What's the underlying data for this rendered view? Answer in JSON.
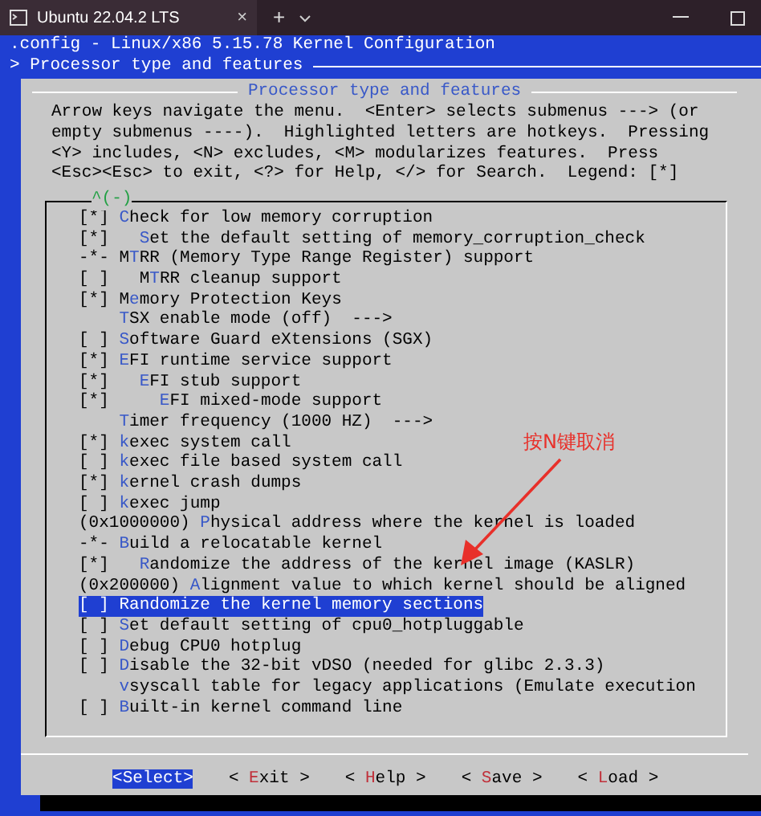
{
  "window": {
    "tab_title": "Ubuntu 22.04.2 LTS",
    "close_tab": "×",
    "new_tab": "+"
  },
  "terminal": {
    "header": ".config - Linux/x86 5.15.78 Kernel Configuration",
    "breadcrumb": "> Processor type and features"
  },
  "dialog": {
    "title": "Processor type and features",
    "help_text": "Arrow keys navigate the menu.  <Enter> selects submenus ---> (or\nempty submenus ----).  Highlighted letters are hotkeys.  Pressing\n<Y> includes, <N> excludes, <M> modularizes features.  Press\n<Esc><Esc> to exit, <?> for Help, </> for Search.  Legend: [*]",
    "scroll_indicator": "^(-)",
    "items": [
      {
        "marker": "[*]",
        "key": "C",
        "post": "heck for low memory corruption",
        "selected": false,
        "children": [
          {
            "marker": "[*]",
            "key": "S",
            "post": "et the default setting of memory_corruption_check",
            "selected": false
          }
        ]
      },
      {
        "marker": "-*-",
        "pre": "M",
        "key": "T",
        "post": "RR (Memory Type Range Register) support",
        "selected": false,
        "children": [
          {
            "marker": "[ ]",
            "pre": "M",
            "key": "T",
            "post": "RR cleanup support",
            "selected": false
          }
        ]
      },
      {
        "marker": "[*]",
        "pre": "M",
        "key": "e",
        "post": "mory Protection Keys",
        "selected": false
      },
      {
        "key": "T",
        "post": "SX enable mode (off)  --->",
        "selected": false
      },
      {
        "marker": "[ ]",
        "key": "S",
        "post": "oftware Guard eXtensions (SGX)",
        "selected": false
      },
      {
        "marker": "[*]",
        "key": "E",
        "post": "FI runtime service support",
        "selected": false,
        "children": [
          {
            "marker": "[*]",
            "key": "E",
            "post": "FI stub support",
            "selected": false,
            "children": [
              {
                "marker": "[*]",
                "key": "E",
                "post": "FI mixed-mode support",
                "selected": false
              }
            ]
          }
        ]
      },
      {
        "key": "T",
        "post": "imer frequency (1000 HZ)  --->",
        "selected": false
      },
      {
        "marker": "[*]",
        "key": "k",
        "post": "exec system call",
        "selected": false
      },
      {
        "marker": "[ ]",
        "key": "k",
        "post": "exec file based system call",
        "selected": false
      },
      {
        "marker": "[*]",
        "key": "k",
        "post": "ernel crash dumps",
        "selected": false
      },
      {
        "marker": "[ ]",
        "key": "k",
        "post": "exec jump",
        "selected": false
      },
      {
        "marker": "(0x1000000)",
        "key": "P",
        "post": "hysical address where the kernel is loaded",
        "selected": false
      },
      {
        "marker": "-*-",
        "key": "B",
        "post": "uild a relocatable kernel",
        "selected": false,
        "children": [
          {
            "marker": "[*]",
            "key": "R",
            "post": "andomize the address of the kernel image (KASLR)",
            "selected": false
          }
        ]
      },
      {
        "marker": "(0x200000)",
        "key": "A",
        "post": "lignment value to which kernel should be aligned",
        "selected": false
      },
      {
        "marker": "[ ]",
        "key": "R",
        "post": "andomize the kernel memory sections",
        "selected": true
      },
      {
        "marker": "[ ]",
        "key": "S",
        "post": "et default setting of cpu0_hotpluggable",
        "selected": false
      },
      {
        "marker": "[ ]",
        "key": "D",
        "post": "ebug CPU0 hotplug",
        "selected": false
      },
      {
        "marker": "[ ]",
        "key": "D",
        "post": "isable the 32-bit vDSO (needed for glibc 2.3.3)",
        "selected": false
      },
      {
        "key": "v",
        "post": "syscall table for legacy applications (Emulate execution",
        "selected": false
      },
      {
        "marker": "[ ]",
        "key": "B",
        "post": "uilt-in kernel command line",
        "selected": false
      }
    ],
    "buttons": [
      {
        "pre": "<",
        "key": "S",
        "post": "elect>",
        "selected": true
      },
      {
        "pre": "< ",
        "key": "E",
        "post": "xit >",
        "selected": false
      },
      {
        "pre": "< ",
        "key": "H",
        "post": "elp >",
        "selected": false
      },
      {
        "pre": "< ",
        "key": "S",
        "post": "ave >",
        "selected": false
      },
      {
        "pre": "< ",
        "key": "L",
        "post": "oad >",
        "selected": false
      }
    ]
  },
  "annotation": {
    "text": "按N键取消"
  }
}
